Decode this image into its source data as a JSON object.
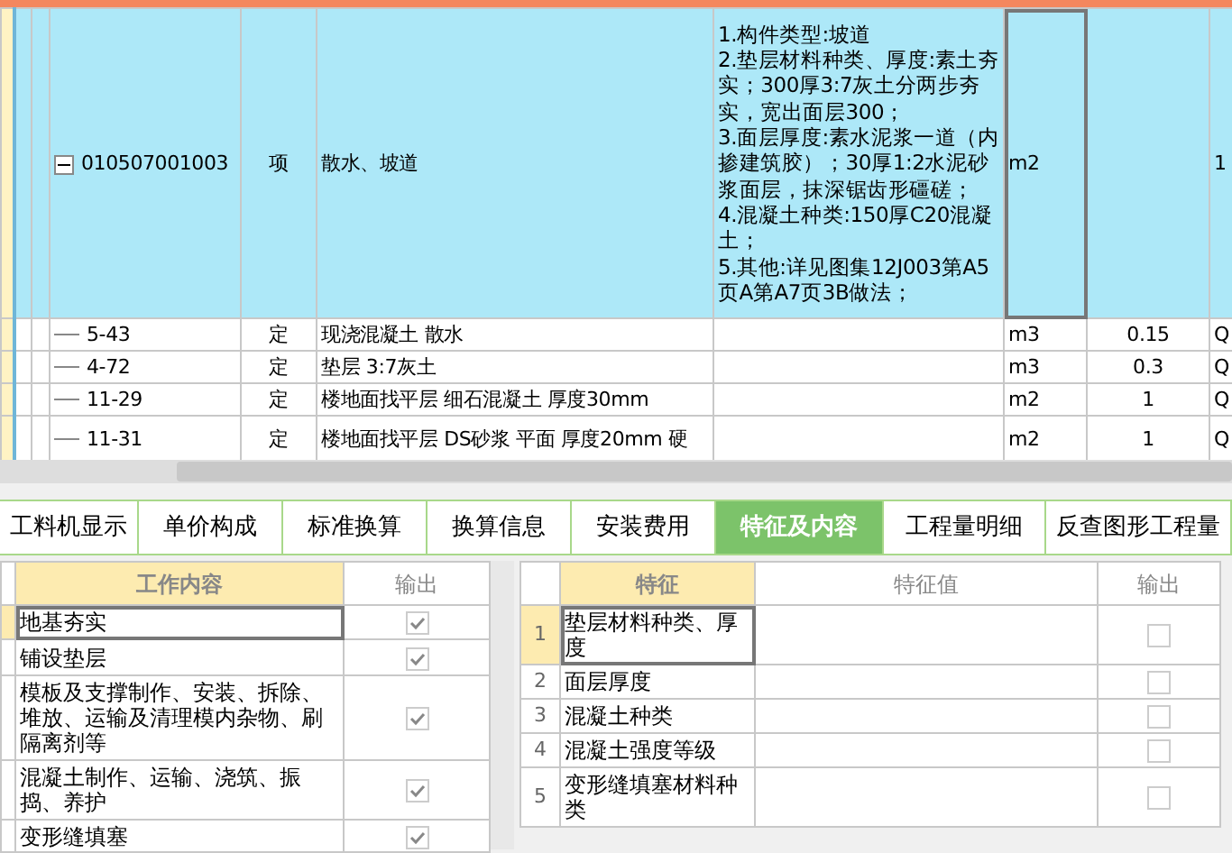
{
  "grid": {
    "rows": [
      {
        "kind": "item",
        "selected": true,
        "expanded": true,
        "code": "010507001003",
        "type": "项",
        "name": "散水、坡道",
        "features": "1.构件类型:坡道\n2.垫层材料种类、厚度:素土夯实；300厚3:7灰土分两步夯实，宽出面层300；\n3.面层厚度:素水泥浆一道（内掺建筑胶）；30厚1:2水泥砂浆面层，抹深锯齿形礓磋；\n4.混凝土种类:150厚C20混凝土；\n5.其他:详见图集12J003第A5页A第A7页3B做法；",
        "unit": "m2",
        "column_9": "1"
      },
      {
        "kind": "quota",
        "selected": false,
        "code": "5-43",
        "type": "定",
        "name": "现浇混凝土 散水",
        "unit": "m3",
        "quantity": "0.15",
        "column_9": "Q"
      },
      {
        "kind": "quota",
        "selected": false,
        "code": "4-72",
        "type": "定",
        "name": "垫层 3:7灰土",
        "unit": "m3",
        "quantity": "0.3",
        "column_9": "Q"
      },
      {
        "kind": "quota",
        "selected": false,
        "code": "11-29",
        "type": "定",
        "name": "楼地面找平层 细石混凝土 厚度30mm",
        "unit": "m2",
        "quantity": "1",
        "column_9": "Q"
      },
      {
        "kind": "quota",
        "selected": false,
        "code": "11-31",
        "type": "定",
        "name": "楼地面找平层 DS砂浆 平面 厚度20mm 硬",
        "unit": "m2",
        "quantity": "1",
        "column_9": "Q"
      }
    ]
  },
  "tabs": [
    {
      "label": "工料机显示",
      "selected": false
    },
    {
      "label": "单价构成",
      "selected": false
    },
    {
      "label": "标准换算",
      "selected": false
    },
    {
      "label": "换算信息",
      "selected": false
    },
    {
      "label": "安装费用",
      "selected": false
    },
    {
      "label": "特征及内容",
      "selected": true
    },
    {
      "label": "工程量明细",
      "selected": false
    },
    {
      "label": "反查图形工程量",
      "selected": false
    }
  ],
  "work_content": {
    "columns": [
      "工作内容",
      "输出"
    ],
    "rows": [
      {
        "text": "地基夯实",
        "checked": true,
        "selected": true
      },
      {
        "text": "铺设垫层",
        "checked": true,
        "selected": false
      },
      {
        "text": "模板及支撑制作、安装、拆除、堆放、运输及清理模内杂物、刷隔离剂等",
        "checked": true,
        "selected": false
      },
      {
        "text": "混凝土制作、运输、浇筑、振捣、养护",
        "checked": true,
        "selected": false
      },
      {
        "text": "变形缝填塞",
        "checked": true,
        "selected": false
      }
    ]
  },
  "features": {
    "columns": [
      "特征",
      "特征值",
      "输出"
    ],
    "rows": [
      {
        "index": "1",
        "name": "垫层材料种类、厚度",
        "checked": false,
        "selected": true
      },
      {
        "index": "2",
        "name": "面层厚度",
        "checked": false,
        "selected": false
      },
      {
        "index": "3",
        "name": "混凝土种类",
        "checked": false,
        "selected": false
      },
      {
        "index": "4",
        "name": "混凝土强度等级",
        "checked": false,
        "selected": false
      },
      {
        "index": "5",
        "name": "变形缝填塞材料种类",
        "checked": false,
        "selected": false
      }
    ]
  }
}
